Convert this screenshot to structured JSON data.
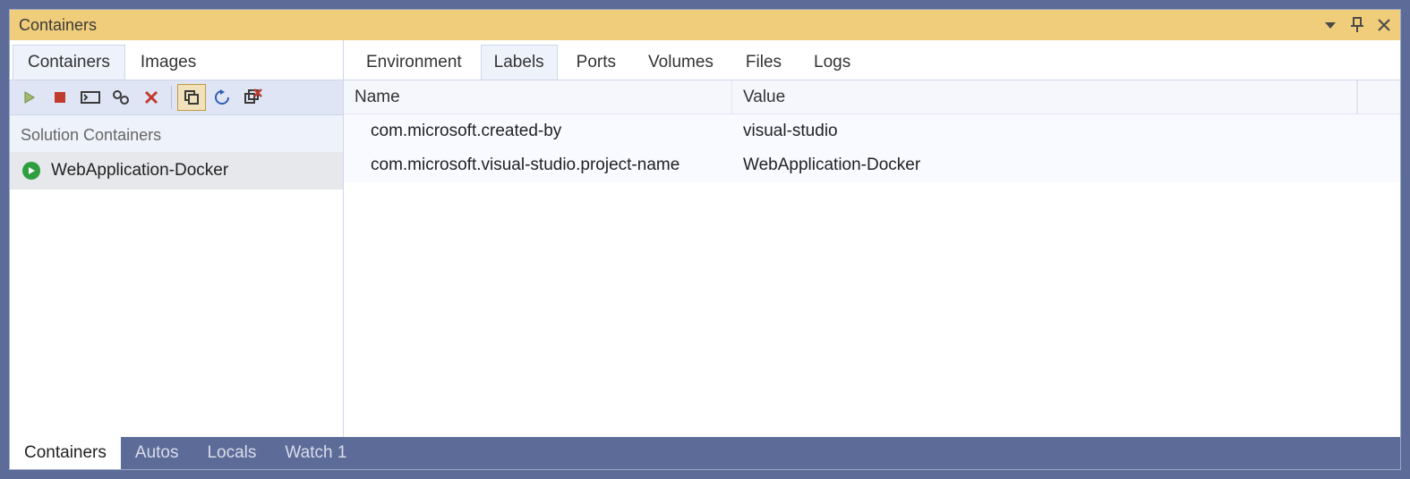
{
  "titlebar": {
    "title": "Containers"
  },
  "left": {
    "tabs": [
      {
        "label": "Containers",
        "active": true
      },
      {
        "label": "Images",
        "active": false
      }
    ],
    "toolbar_icons": [
      "play",
      "stop",
      "terminal",
      "gear",
      "delete",
      "sep",
      "copy-selected",
      "refresh",
      "remove-multi"
    ],
    "section_label": "Solution Containers",
    "items": [
      {
        "name": "WebApplication-Docker",
        "running": true,
        "selected": true
      }
    ]
  },
  "right": {
    "tabs": [
      {
        "label": "Environment",
        "active": false
      },
      {
        "label": "Labels",
        "active": true
      },
      {
        "label": "Ports",
        "active": false
      },
      {
        "label": "Volumes",
        "active": false
      },
      {
        "label": "Files",
        "active": false
      },
      {
        "label": "Logs",
        "active": false
      }
    ],
    "columns": {
      "name": "Name",
      "value": "Value"
    },
    "rows": [
      {
        "name": "com.microsoft.created-by",
        "value": "visual-studio"
      },
      {
        "name": "com.microsoft.visual-studio.project-name",
        "value": "WebApplication-Docker"
      }
    ]
  },
  "bottom_tabs": [
    {
      "label": "Containers",
      "active": true
    },
    {
      "label": "Autos",
      "active": false
    },
    {
      "label": "Locals",
      "active": false
    },
    {
      "label": "Watch 1",
      "active": false
    }
  ]
}
